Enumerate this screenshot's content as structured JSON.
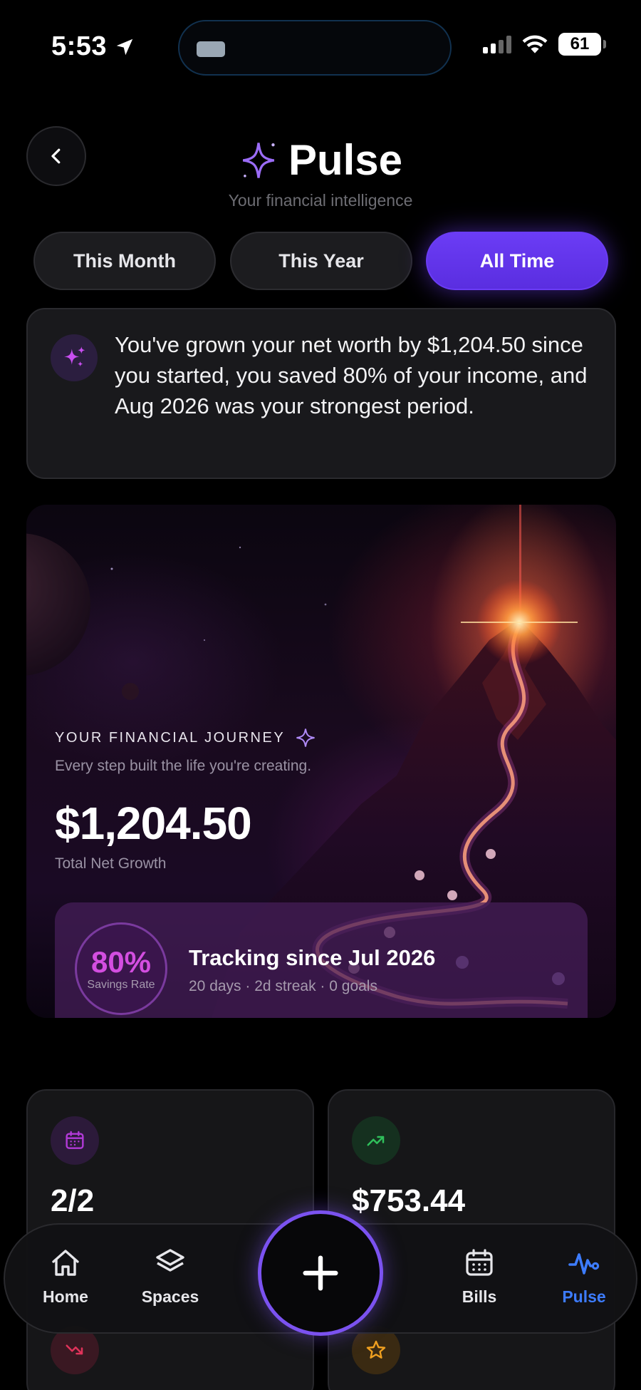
{
  "status_bar": {
    "time": "5:53",
    "battery": "61"
  },
  "header": {
    "title": "Pulse",
    "subtitle": "Your financial intelligence"
  },
  "periods": [
    {
      "label": "This Month",
      "active": false
    },
    {
      "label": "This Year",
      "active": false
    },
    {
      "label": "All Time",
      "active": true
    }
  ],
  "insight": {
    "text": "You've grown your net worth by $1,204.50 since you started, you saved 80% of your income, and Aug 2026 was your strongest period."
  },
  "journey": {
    "kicker": "YOUR FINANCIAL JOURNEY",
    "subtitle": "Every step built the life you're creating.",
    "amount": "$1,204.50",
    "amount_label": "Total Net Growth",
    "savings_rate": "80%",
    "savings_rate_label": "Savings Rate",
    "tracking_title": "Tracking since Jul 2026",
    "tracking_meta": "20 days · 2d streak · 0 goals"
  },
  "stats": [
    {
      "icon": "calendar-icon",
      "value": "2/2",
      "accent": "#b23ad8",
      "next_icon": "trending-down-icon",
      "next_accent": "#e0335a"
    },
    {
      "icon": "trending-up-icon",
      "value": "$753.44",
      "accent": "#2fbf5b",
      "next_icon": "star-icon",
      "next_accent": "#f0a020"
    }
  ],
  "tabbar": {
    "items": [
      {
        "label": "Home",
        "icon": "home-icon"
      },
      {
        "label": "Spaces",
        "icon": "layers-icon"
      },
      {
        "label": "Bills",
        "icon": "calendar-icon"
      },
      {
        "label": "Pulse",
        "icon": "pulse-icon",
        "active": true
      }
    ],
    "fab_icon": "plus-icon"
  },
  "colors": {
    "accent": "#6b3cf5",
    "active_tab": "#3d7cff",
    "background": "#000000"
  }
}
